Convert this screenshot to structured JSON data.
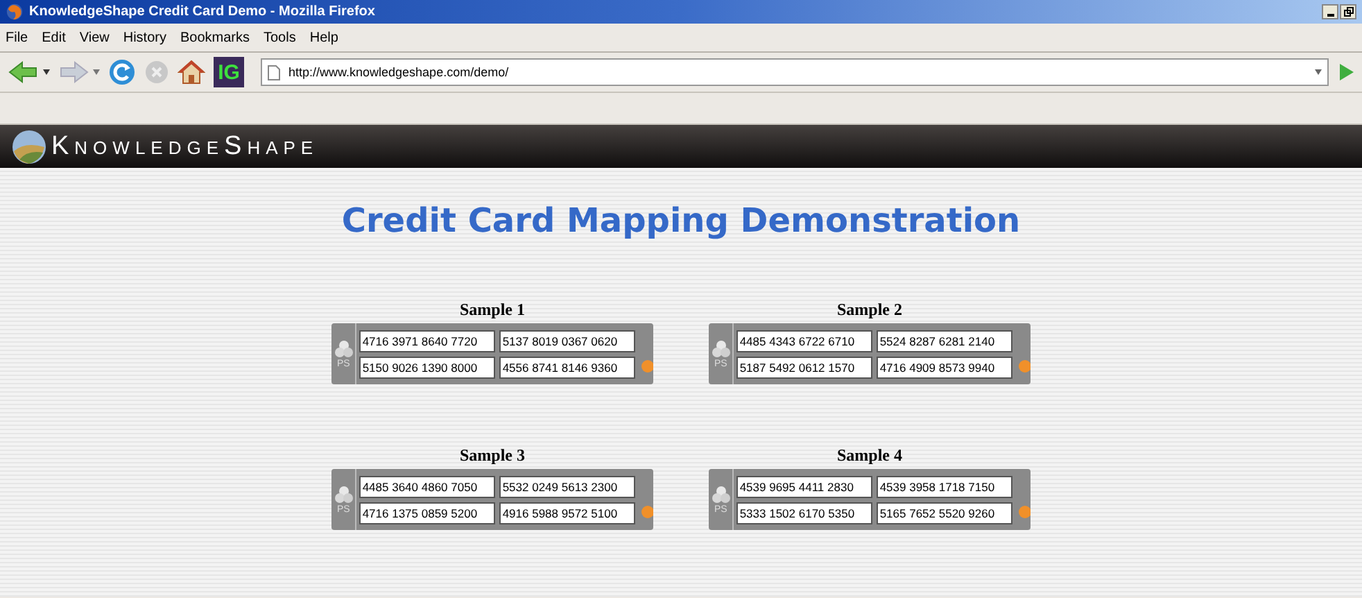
{
  "window": {
    "title": "KnowledgeShape Credit Card Demo - Mozilla Firefox"
  },
  "menu": [
    "File",
    "Edit",
    "View",
    "History",
    "Bookmarks",
    "Tools",
    "Help"
  ],
  "toolbar": {
    "addon_label": "IG",
    "url": "http://www.knowledgeshape.com/demo/"
  },
  "site": {
    "logo": "KnowledgeShape"
  },
  "page": {
    "heading": "Credit Card Mapping Demonstration"
  },
  "samples": [
    {
      "title": "Sample 1",
      "side_label": "PS",
      "cards": [
        "4716 3971 8640 7720",
        "5137 8019 0367 0620",
        "5150 9026 1390 8000",
        "4556 8741 8146 9360"
      ]
    },
    {
      "title": "Sample 2",
      "side_label": "PS",
      "cards": [
        "4485 4343 6722 6710",
        "5524 8287 6281 2140",
        "5187 5492 0612 1570",
        "4716 4909 8573 9940"
      ]
    },
    {
      "title": "Sample 3",
      "side_label": "PS",
      "cards": [
        "4485 3640 4860 7050",
        "5532 0249 5613 2300",
        "4716 1375 0859 5200",
        "4916 5988 9572 5100"
      ]
    },
    {
      "title": "Sample 4",
      "side_label": "PS",
      "cards": [
        "4539 9695 4411 2830",
        "4539 3958 1718 7150",
        "5333 1502 6170 5350",
        "5165 7652 5520 9260"
      ]
    }
  ]
}
